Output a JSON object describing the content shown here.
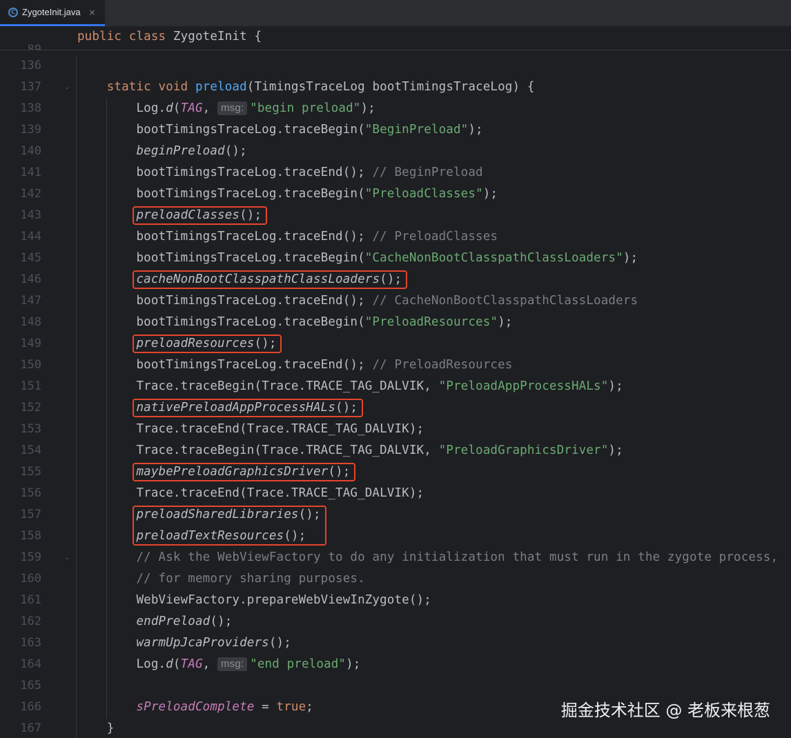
{
  "tab": {
    "icon": "class-icon",
    "filename": "ZygoteInit.java",
    "close_glyph": "×"
  },
  "sticky": {
    "line_number": "89",
    "code": [
      {
        "t": "public class ",
        "c": "kw"
      },
      {
        "t": "ZygoteInit {",
        "c": ""
      }
    ]
  },
  "lines": [
    {
      "n": "136",
      "code": []
    },
    {
      "n": "137",
      "code": [
        {
          "t": "    "
        },
        {
          "t": "static void ",
          "c": "kw"
        },
        {
          "t": "preload",
          "c": "fn"
        },
        {
          "t": "(TimingsTraceLog bootTimingsTraceLog) {"
        }
      ]
    },
    {
      "n": "138",
      "code": [
        {
          "t": "        Log."
        },
        {
          "t": "d",
          "c": "it"
        },
        {
          "t": "("
        },
        {
          "t": "TAG",
          "c": "tag"
        },
        {
          "t": ", "
        },
        {
          "t": "msg:",
          "c": "hint"
        },
        {
          "t": "\"begin preload\"",
          "c": "str"
        },
        {
          "t": ");"
        }
      ]
    },
    {
      "n": "139",
      "code": [
        {
          "t": "        bootTimingsTraceLog.traceBegin("
        },
        {
          "t": "\"BeginPreload\"",
          "c": "str"
        },
        {
          "t": ");"
        }
      ]
    },
    {
      "n": "140",
      "code": [
        {
          "t": "        "
        },
        {
          "t": "beginPreload",
          "c": "it"
        },
        {
          "t": "();"
        }
      ]
    },
    {
      "n": "141",
      "code": [
        {
          "t": "        bootTimingsTraceLog.traceEnd(); "
        },
        {
          "t": "// BeginPreload",
          "c": "cm"
        }
      ]
    },
    {
      "n": "142",
      "code": [
        {
          "t": "        bootTimingsTraceLog.traceBegin("
        },
        {
          "t": "\"PreloadClasses\"",
          "c": "str"
        },
        {
          "t": ");"
        }
      ]
    },
    {
      "n": "143",
      "code": [
        {
          "t": "        "
        },
        {
          "t": "preloadClasses",
          "c": "it"
        },
        {
          "t": "();"
        }
      ]
    },
    {
      "n": "144",
      "code": [
        {
          "t": "        bootTimingsTraceLog.traceEnd(); "
        },
        {
          "t": "// PreloadClasses",
          "c": "cm"
        }
      ]
    },
    {
      "n": "145",
      "code": [
        {
          "t": "        bootTimingsTraceLog.traceBegin("
        },
        {
          "t": "\"CacheNonBootClasspathClassLoaders\"",
          "c": "str"
        },
        {
          "t": ");"
        }
      ]
    },
    {
      "n": "146",
      "code": [
        {
          "t": "        "
        },
        {
          "t": "cacheNonBootClasspathClassLoaders",
          "c": "it"
        },
        {
          "t": "();"
        }
      ]
    },
    {
      "n": "147",
      "code": [
        {
          "t": "        bootTimingsTraceLog.traceEnd(); "
        },
        {
          "t": "// CacheNonBootClasspathClassLoaders",
          "c": "cm"
        }
      ]
    },
    {
      "n": "148",
      "code": [
        {
          "t": "        bootTimingsTraceLog.traceBegin("
        },
        {
          "t": "\"PreloadResources\"",
          "c": "str"
        },
        {
          "t": ");"
        }
      ]
    },
    {
      "n": "149",
      "code": [
        {
          "t": "        "
        },
        {
          "t": "preloadResources",
          "c": "it"
        },
        {
          "t": "();"
        }
      ]
    },
    {
      "n": "150",
      "code": [
        {
          "t": "        bootTimingsTraceLog.traceEnd(); "
        },
        {
          "t": "// PreloadResources",
          "c": "cm"
        }
      ]
    },
    {
      "n": "151",
      "code": [
        {
          "t": "        Trace.traceBegin(Trace.TRACE_TAG_DALVIK, "
        },
        {
          "t": "\"PreloadAppProcessHALs\"",
          "c": "str"
        },
        {
          "t": ");"
        }
      ]
    },
    {
      "n": "152",
      "code": [
        {
          "t": "        "
        },
        {
          "t": "nativePreloadAppProcessHALs",
          "c": "it"
        },
        {
          "t": "();"
        }
      ]
    },
    {
      "n": "153",
      "code": [
        {
          "t": "        Trace.traceEnd(Trace.TRACE_TAG_DALVIK);"
        }
      ]
    },
    {
      "n": "154",
      "code": [
        {
          "t": "        Trace.traceBegin(Trace.TRACE_TAG_DALVIK, "
        },
        {
          "t": "\"PreloadGraphicsDriver\"",
          "c": "str"
        },
        {
          "t": ");"
        }
      ]
    },
    {
      "n": "155",
      "code": [
        {
          "t": "        "
        },
        {
          "t": "maybePreloadGraphicsDriver",
          "c": "it"
        },
        {
          "t": "();"
        }
      ]
    },
    {
      "n": "156",
      "code": [
        {
          "t": "        Trace.traceEnd(Trace.TRACE_TAG_DALVIK);"
        }
      ]
    },
    {
      "n": "157",
      "code": [
        {
          "t": "        "
        },
        {
          "t": "preloadSharedLibraries",
          "c": "it"
        },
        {
          "t": "();"
        }
      ]
    },
    {
      "n": "158",
      "code": [
        {
          "t": "        "
        },
        {
          "t": "preloadTextResources",
          "c": "it"
        },
        {
          "t": "();"
        }
      ]
    },
    {
      "n": "159",
      "code": [
        {
          "t": "        "
        },
        {
          "t": "// Ask the WebViewFactory to do any initialization that must run in the zygote process,",
          "c": "cm"
        }
      ]
    },
    {
      "n": "160",
      "code": [
        {
          "t": "        "
        },
        {
          "t": "// for memory sharing purposes.",
          "c": "cm"
        }
      ]
    },
    {
      "n": "161",
      "code": [
        {
          "t": "        WebViewFactory.prepareWebViewInZygote();"
        }
      ]
    },
    {
      "n": "162",
      "code": [
        {
          "t": "        "
        },
        {
          "t": "endPreload",
          "c": "it"
        },
        {
          "t": "();"
        }
      ]
    },
    {
      "n": "163",
      "code": [
        {
          "t": "        "
        },
        {
          "t": "warmUpJcaProviders",
          "c": "it"
        },
        {
          "t": "();"
        }
      ]
    },
    {
      "n": "164",
      "code": [
        {
          "t": "        Log."
        },
        {
          "t": "d",
          "c": "it"
        },
        {
          "t": "("
        },
        {
          "t": "TAG",
          "c": "tag"
        },
        {
          "t": ", "
        },
        {
          "t": "msg:",
          "c": "hint"
        },
        {
          "t": "\"end preload\"",
          "c": "str"
        },
        {
          "t": ");"
        }
      ]
    },
    {
      "n": "165",
      "code": []
    },
    {
      "n": "166",
      "code": [
        {
          "t": "        "
        },
        {
          "t": "sPreloadComplete",
          "c": "stc"
        },
        {
          "t": " = "
        },
        {
          "t": "true",
          "c": "kw"
        },
        {
          "t": ";"
        }
      ]
    },
    {
      "n": "167",
      "code": [
        {
          "t": "    }"
        }
      ]
    }
  ],
  "folds": {
    "137": "⌄",
    "159": "⌄"
  },
  "highlights": [
    {
      "line": "143"
    },
    {
      "line": "146"
    },
    {
      "line": "149"
    },
    {
      "line": "152"
    },
    {
      "line": "155"
    },
    {
      "line": "157-158"
    }
  ],
  "watermark": "掘金技术社区 @ 老板来根葱"
}
